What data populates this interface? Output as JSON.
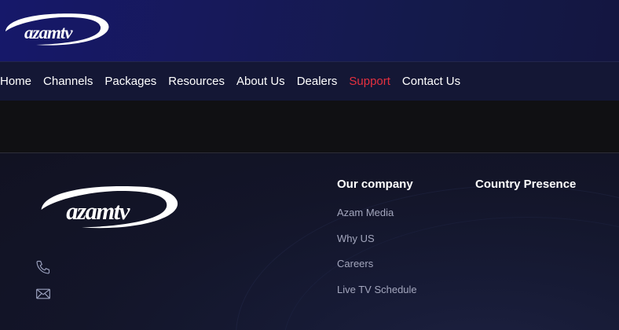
{
  "brand": {
    "name": "azamtv"
  },
  "nav": {
    "items": [
      {
        "label": "Home"
      },
      {
        "label": "Channels"
      },
      {
        "label": "Packages"
      },
      {
        "label": "Resources"
      },
      {
        "label": "About Us"
      },
      {
        "label": "Dealers"
      },
      {
        "label": "Support",
        "active": true
      },
      {
        "label": "Contact Us"
      }
    ]
  },
  "footer": {
    "contact": {
      "icons": [
        "phone-icon",
        "mail-icon"
      ]
    },
    "company": {
      "title": "Our company",
      "links": [
        "Azam Media",
        "Why US",
        "Careers",
        "Live TV Schedule"
      ]
    },
    "country": {
      "title": "Country Presence"
    }
  },
  "colors": {
    "header_bg": "#16186a",
    "nav_bg": "#141735",
    "active": "#e5303f",
    "footer_bg": "#131529",
    "link": "#a3a6bd"
  }
}
